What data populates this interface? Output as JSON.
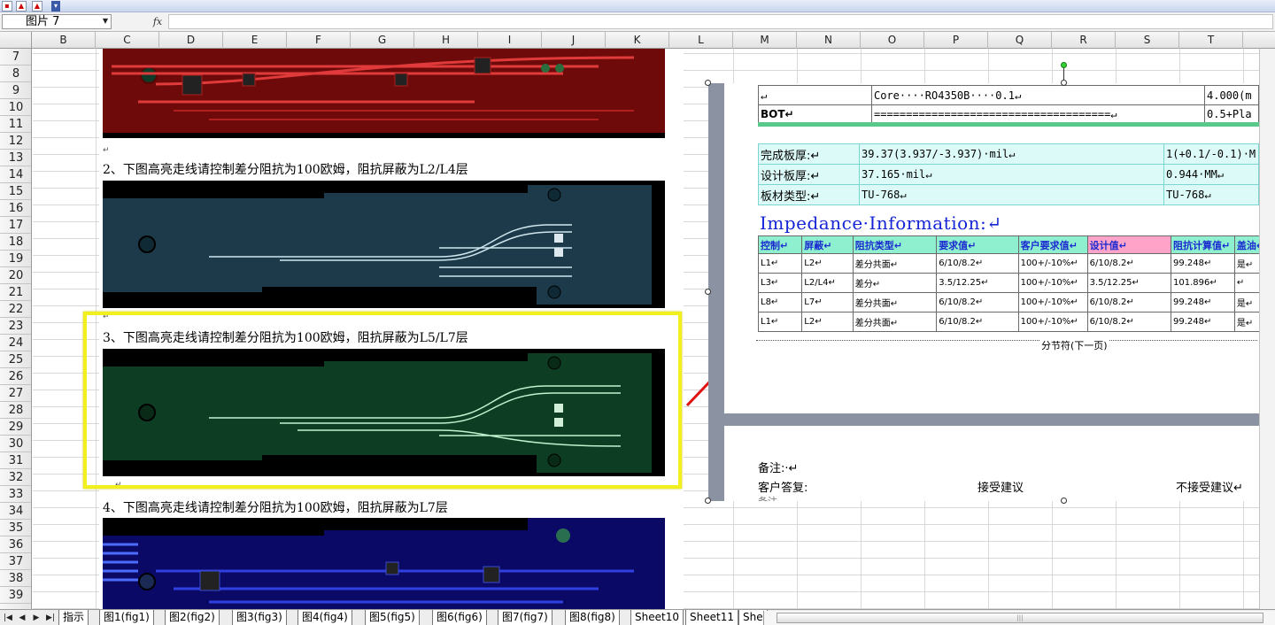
{
  "toolbar": {
    "icons": [
      "app-icon",
      "pdf-icon",
      "pdf-export-icon"
    ]
  },
  "formula_bar": {
    "name_box": "图片 7",
    "fx_label": "fx",
    "formula": ""
  },
  "columns": [
    "B",
    "C",
    "D",
    "E",
    "F",
    "G",
    "H",
    "I",
    "J",
    "K",
    "L",
    "M",
    "N",
    "O",
    "P",
    "Q",
    "R",
    "S",
    "T"
  ],
  "rows": [
    "7",
    "8",
    "9",
    "10",
    "11",
    "12",
    "13",
    "14",
    "15",
    "16",
    "17",
    "18",
    "19",
    "20",
    "21",
    "22",
    "23",
    "24",
    "25",
    "26",
    "27",
    "28",
    "29",
    "30",
    "31",
    "32",
    "33",
    "34",
    "35",
    "36",
    "37",
    "38",
    "39"
  ],
  "left_doc": {
    "captions": [
      "2、下图高亮走线请控制差分阻抗为100欧姆，阻抗屏蔽为L2/L4层",
      "3、下图高亮走线请控制差分阻抗为100欧姆，阻抗屏蔽为L5/L7层",
      "4、下图高亮走线请控制差分阻抗为100欧姆，阻抗屏蔽为L7层"
    ],
    "para_mark": "↵",
    "pcb_colors": [
      "#7a0a0a",
      "#1d3a4a",
      "#0d3d22",
      "#0a0a66"
    ]
  },
  "right_doc": {
    "stack": [
      [
        "↵",
        "Core····RO4350B····0.1↵",
        "4.000(m"
      ],
      [
        "BOT↵",
        "=====================================↵",
        "0.5+Pla"
      ]
    ],
    "board_info": [
      [
        "完成板厚:↵",
        "39.37(3.937/-3.937)·mil↵",
        "1(+0.1/-0.1)·M"
      ],
      [
        "设计板厚:↵",
        "37.165·mil↵",
        "0.944·MM↵"
      ],
      [
        "板材类型:↵",
        "TU-768↵",
        "TU-768↵"
      ]
    ],
    "impedance_title": "Impedance·Information:↵",
    "impedance_headers": [
      "控制↵",
      "屏蔽↵",
      "阻抗类型↵",
      "要求值↵",
      "客户要求值↵",
      "设计值↵",
      "阻抗计算值↵",
      "盖油↵"
    ],
    "impedance_rows": [
      [
        "L1↵",
        "L2↵",
        "差分共面↵",
        "6/10/8.2↵",
        "100+/-10%↵",
        "6/10/8.2↵",
        "99.248↵",
        "是↵"
      ],
      [
        "L3↵",
        "L2/L4↵",
        "差分↵",
        "3.5/12.25↵",
        "100+/-10%↵",
        "3.5/12.25↵",
        "101.896↵",
        "↵"
      ],
      [
        "L8↵",
        "L7↵",
        "差分共面↵",
        "6/10/8.2↵",
        "100+/-10%↵",
        "6/10/8.2↵",
        "99.248↵",
        "是↵"
      ],
      [
        "L1↵",
        "L2↵",
        "差分共面↵",
        "6/10/8.2↵",
        "100+/-10%↵",
        "6/10/8.2↵",
        "99.248↵",
        "是↵"
      ]
    ],
    "section_break": "分节符(下一页)",
    "notes": {
      "remark": "备注:·↵",
      "reply_label": "客户答复:",
      "accept": "接受建议",
      "reject": "不接受建议↵",
      "more": "备注"
    }
  },
  "sheet_tabs": [
    "指示",
    "图1(fig1)",
    "图2(fig2)",
    "图3(fig3)",
    "图4(fig4)",
    "图5(fig5)",
    "图6(fig6)",
    "图7(fig7)",
    "图8(fig8)",
    "Sheet10",
    "Sheet11",
    "She"
  ],
  "colors": {
    "highlight": "#f2ef1f",
    "arrow": "#e01010",
    "impedance_title": "#1426d6"
  }
}
